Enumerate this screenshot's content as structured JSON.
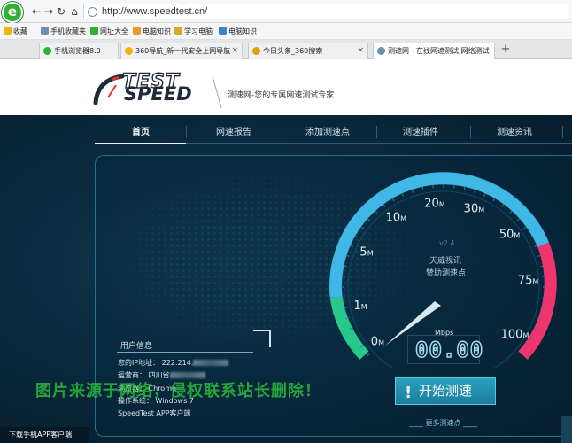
{
  "browser": {
    "logo_letter": "e",
    "url": "http://www.speedtest.cn/",
    "nav": {
      "back": "←",
      "forward": "→",
      "refresh": "↻",
      "home": "⌂"
    }
  },
  "favorites": [
    {
      "label": "收藏",
      "icon": "star-icon",
      "color": "#f4b400"
    },
    {
      "label": "手机收藏夹",
      "icon": "phone-icon",
      "color": "#6b8fb3"
    },
    {
      "label": "网址大全",
      "icon": "ie-icon",
      "color": "#2eb135"
    },
    {
      "label": "电脑知识",
      "icon": "folder-icon",
      "color": "#e79a28"
    },
    {
      "label": "学习电脑",
      "icon": "bulb-icon",
      "color": "#d9a630"
    },
    {
      "label": "电脑知识",
      "icon": "bn-icon",
      "color": "#3f7fcf"
    }
  ],
  "tabs": [
    {
      "label": "手机浏览器8.0",
      "color": "#2eb135",
      "active": false
    },
    {
      "label": "360导航_新一代安全上网导航",
      "color": "#f0b400",
      "active": false
    },
    {
      "label": "今日头条_360搜索",
      "color": "#e0a000",
      "active": false
    },
    {
      "label": "测速网 - 在线网速测试,网络测试",
      "color": "#6b8fb3",
      "active": true
    }
  ],
  "site": {
    "logo_test": "TEST",
    "logo_speed": "SPEED",
    "tagline": "测速网-您的专属网速测试专家"
  },
  "menu": [
    "首页",
    "网速报告",
    "添加测速点",
    "测速插件",
    "测速资讯"
  ],
  "gauge": {
    "labels": [
      "0M",
      "1M",
      "5M",
      "10M",
      "20M",
      "30M",
      "50M",
      "75M",
      "100M"
    ],
    "version": "v2.4",
    "provider_line1": "天威视讯",
    "provider_line2": "赞助测速点",
    "unit": "Mbps",
    "reading": "00.00",
    "colors": {
      "blue": "#3fb8e6",
      "green": "#27c98a",
      "red": "#f0346e"
    }
  },
  "user_info": {
    "title": "用户信息",
    "ip": "您的IP地址： 222.214.",
    "isp": "运营商： 四川省",
    "browser": "浏览器： Chrome",
    "os": "操作系统： Windows 7",
    "app": "SpeedTest APP客户端"
  },
  "start_button": "开始测速",
  "start_button_prefix": "!",
  "more_nodes": "____ 更多测速点 ____",
  "app_download": "下载手机APP客户端",
  "watermark": "图片来源于网络，侵权联系站长删除！"
}
